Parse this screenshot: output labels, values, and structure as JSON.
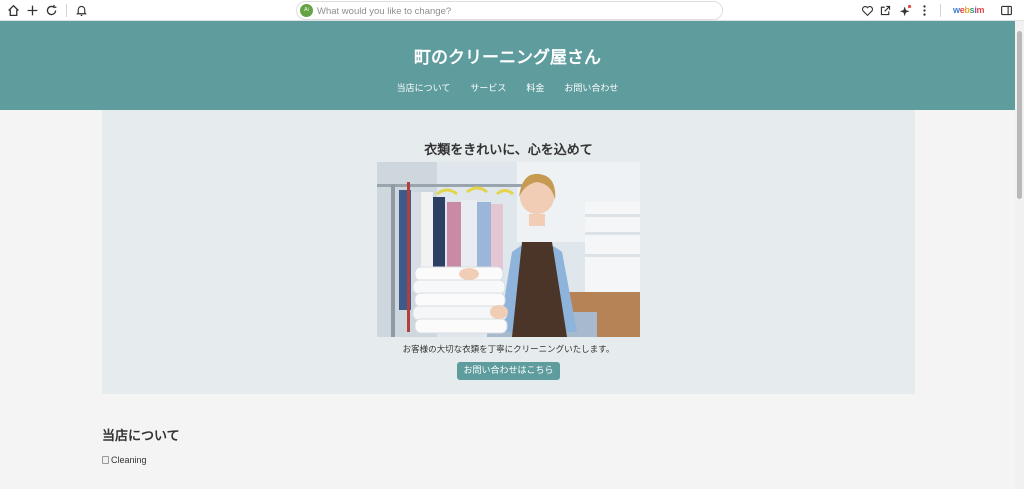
{
  "browser": {
    "address_placeholder": "What would you like to change?",
    "address_badge": "Ai",
    "logo_letters": [
      "w",
      "e",
      "b",
      "s",
      "i",
      "m"
    ],
    "icons": [
      "home-icon",
      "plus-icon",
      "refresh-icon",
      "bell-icon",
      "heart-icon",
      "external-link-icon",
      "sparkle-icon",
      "more-vertical-icon",
      "sidebar-icon"
    ]
  },
  "site": {
    "title": "町のクリーニング屋さん",
    "nav": [
      {
        "label": "当店について"
      },
      {
        "label": "サービス"
      },
      {
        "label": "料金"
      },
      {
        "label": "お問い合わせ"
      }
    ],
    "colors": {
      "header": "#5e9c9e",
      "hero_bg": "#e6ebed",
      "button": "#5e9c9e"
    }
  },
  "hero": {
    "title": "衣類をきれいに、心を込めて",
    "photo_alt": "Cleaning",
    "caption": "お客様の大切な衣類を丁寧にクリーニングいたします。",
    "button": "お問い合わせはこちら"
  },
  "about": {
    "title": "当店について",
    "image_alt": "Cleaning"
  }
}
